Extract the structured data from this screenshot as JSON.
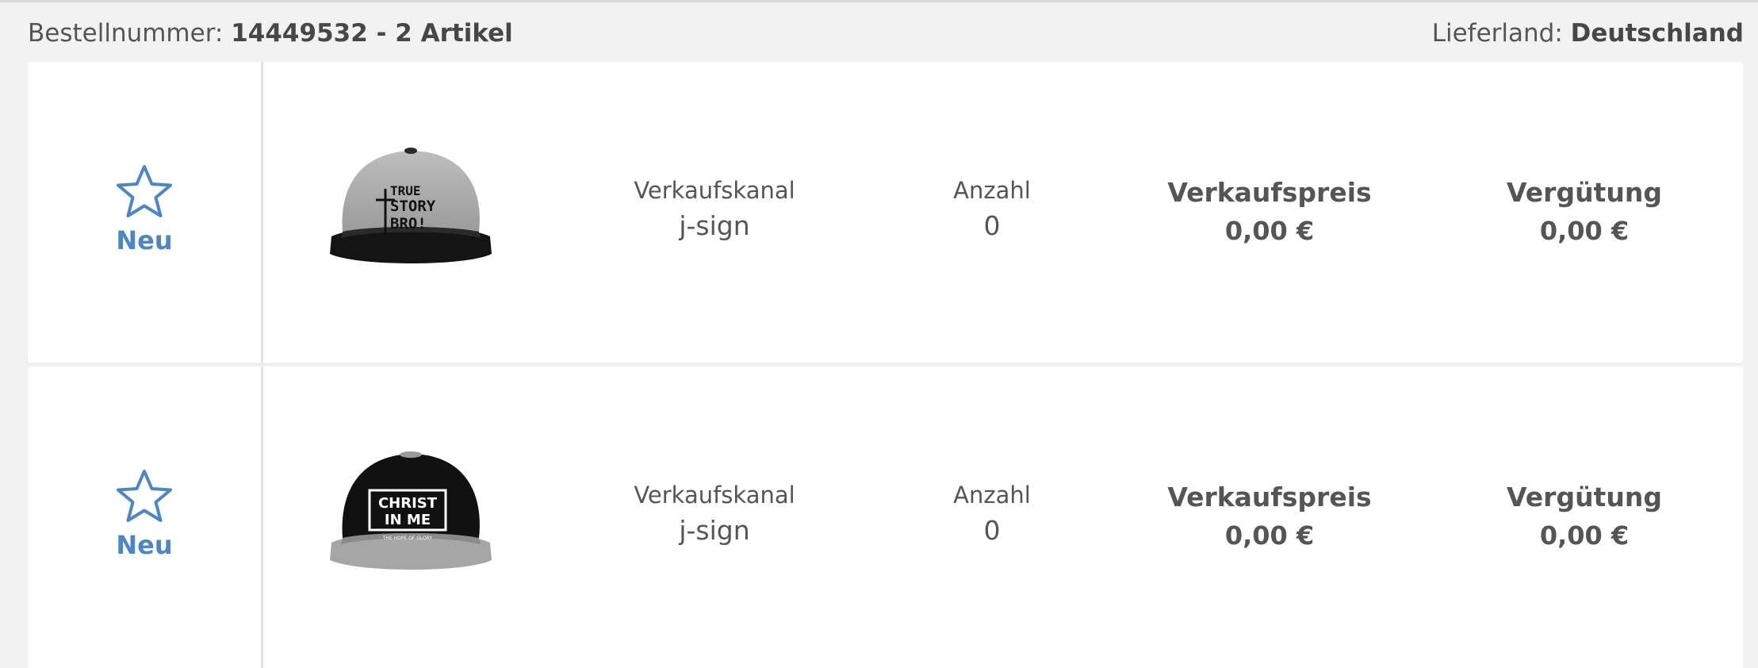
{
  "order": {
    "number_label": "Bestellnummer:",
    "number": "14449532",
    "separator": " - ",
    "count": "2 Artikel",
    "country_label": "Lieferland:",
    "country": "Deutschland"
  },
  "items": [
    {
      "status": "Neu",
      "status_icon": "star-outline-icon",
      "product_image": "grey-black-snapback-cap-true-story-bro",
      "print_text": [
        "TRUE",
        "STORY",
        "BRO!"
      ],
      "channel_label": "Verkaufskanal",
      "channel": "j-sign",
      "qty_label": "Anzahl",
      "qty": "0",
      "price_label": "Verkaufspreis",
      "price": "0,00 €",
      "fee_label": "Vergütung",
      "fee": "0,00 €"
    },
    {
      "status": "Neu",
      "status_icon": "star-outline-icon",
      "product_image": "black-grey-snapback-cap-christ-in-me",
      "print_text": [
        "CHRIST",
        "IN ME",
        "THE HOPE OF GLORY"
      ],
      "channel_label": "Verkaufskanal",
      "channel": "j-sign",
      "qty_label": "Anzahl",
      "qty": "0",
      "price_label": "Verkaufspreis",
      "price": "0,00 €",
      "fee_label": "Vergütung",
      "fee": "0,00 €"
    }
  ],
  "colors": {
    "accent": "#4a86c8",
    "background": "#f2f2f2",
    "card": "#ffffff",
    "text": "#555555"
  }
}
